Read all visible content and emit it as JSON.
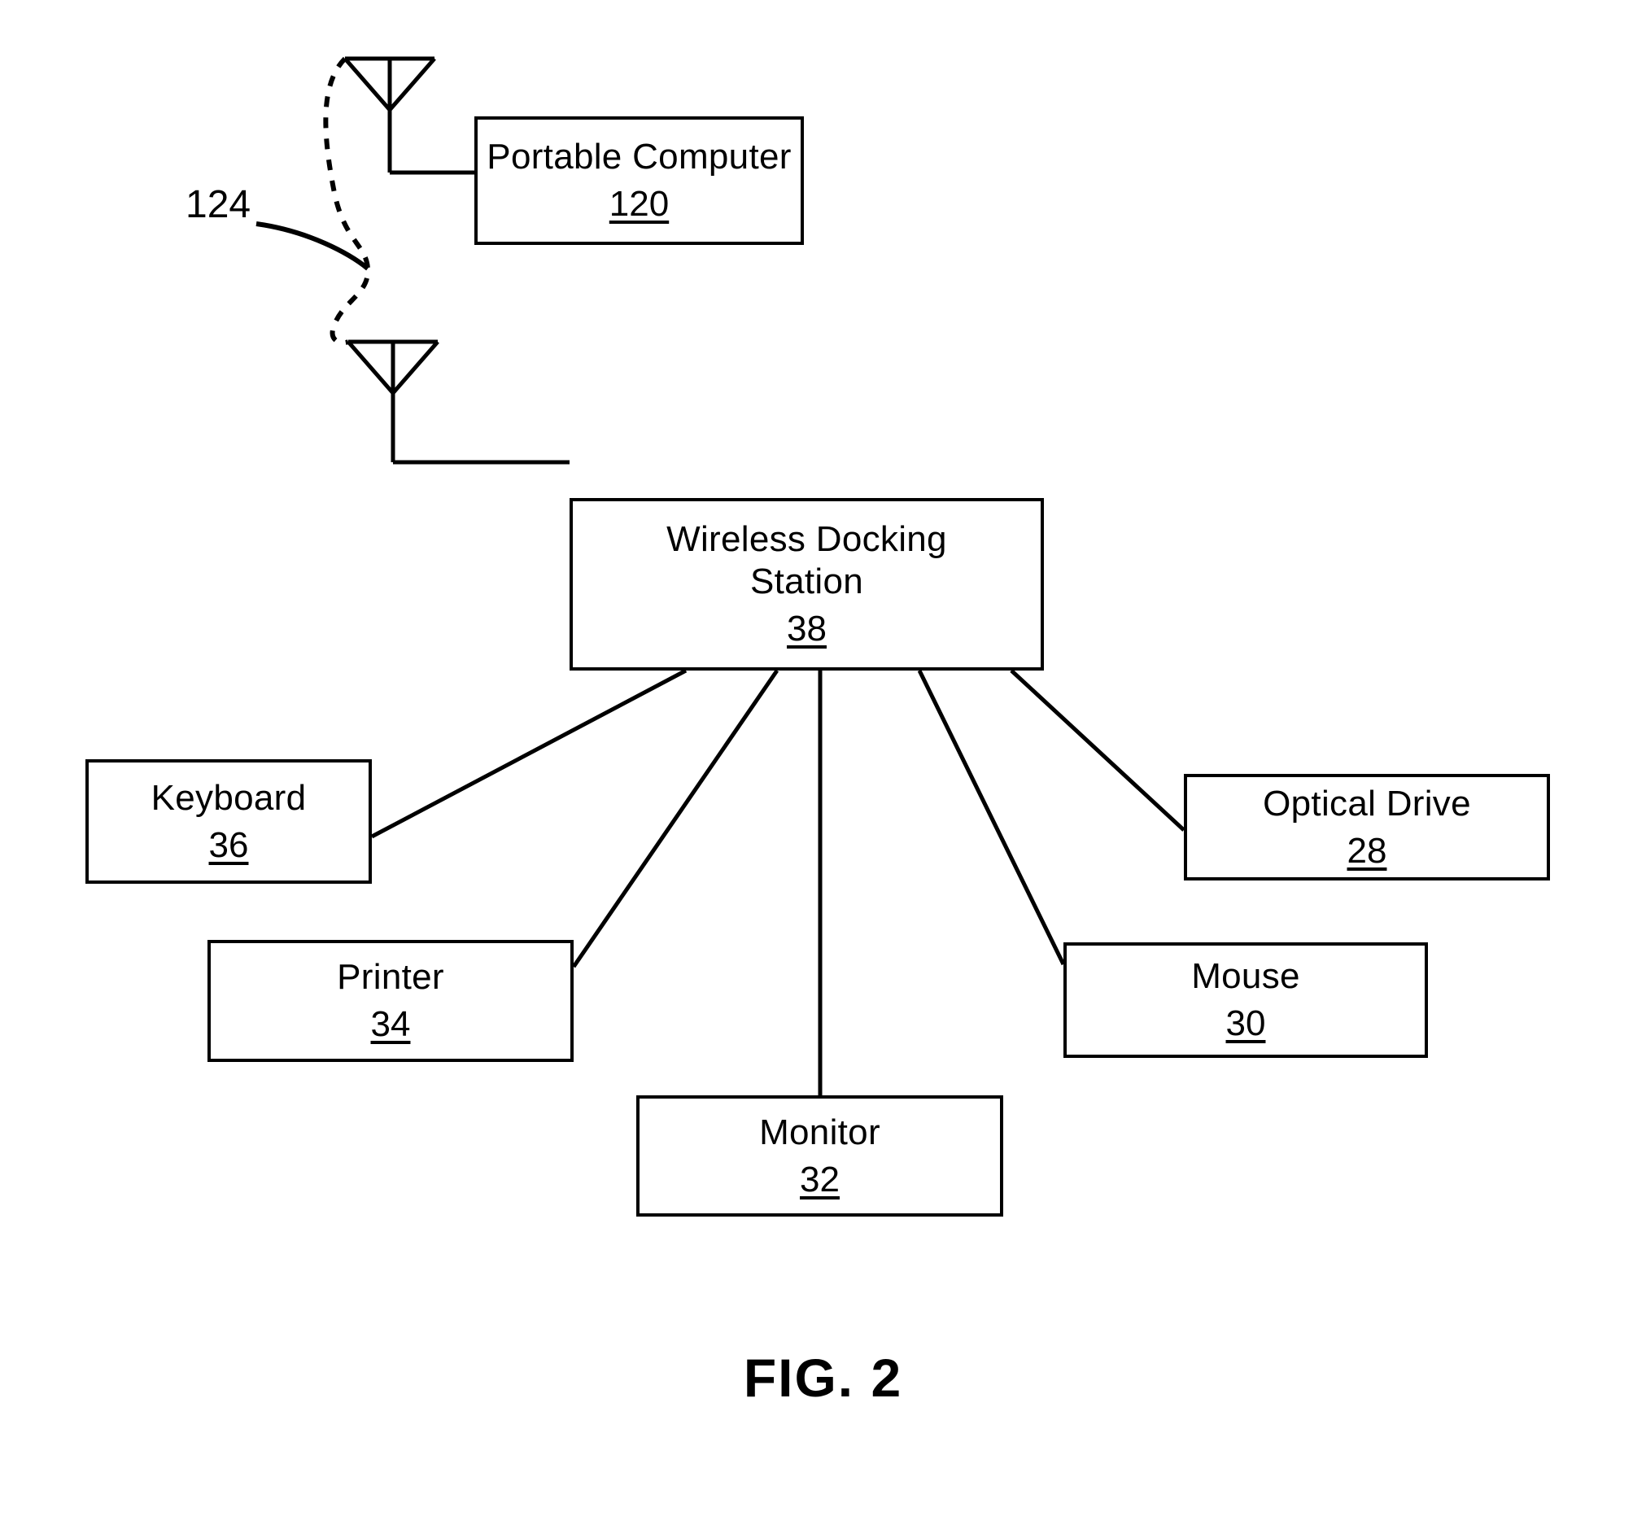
{
  "figure": {
    "caption": "FIG. 2",
    "callout_ref": "124"
  },
  "nodes": {
    "portable_computer": {
      "label": "Portable Computer",
      "ref": "120"
    },
    "docking_station": {
      "label": "Wireless Docking\nStation",
      "ref": "38"
    },
    "keyboard": {
      "label": "Keyboard",
      "ref": "36"
    },
    "optical_drive": {
      "label": "Optical Drive",
      "ref": "28"
    },
    "printer": {
      "label": "Printer",
      "ref": "34"
    },
    "mouse": {
      "label": "Mouse",
      "ref": "30"
    },
    "monitor": {
      "label": "Monitor",
      "ref": "32"
    }
  },
  "icons": {
    "antenna_top": "antenna-icon",
    "antenna_bottom": "antenna-icon"
  },
  "style": {
    "stroke": "#000000",
    "background": "#ffffff",
    "stroke_width": 4
  }
}
